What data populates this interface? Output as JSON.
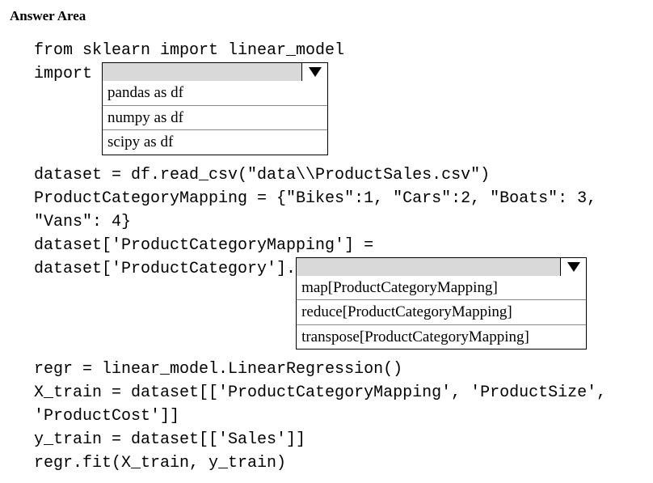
{
  "header": "Answer Area",
  "code": {
    "line1": "from sklearn import linear_model",
    "line2_prefix": "import ",
    "line3": "dataset = df.read_csv(\"data\\\\ProductSales.csv\")",
    "line4": "ProductCategoryMapping = {\"Bikes\":1, \"Cars\":2, \"Boats\": 3,",
    "line5": "\"Vans\": 4}",
    "line6": "dataset['ProductCategoryMapping'] =",
    "line7_prefix": "dataset['ProductCategory'].",
    "line8": "regr = linear_model.LinearRegression()",
    "line9": "X_train = dataset[['ProductCategoryMapping', 'ProductSize',",
    "line10": "'ProductCost']]",
    "line11": "y_train = dataset[['Sales']]",
    "line12": "regr.fit(X_train, y_train)"
  },
  "dropdown1": {
    "selected": "",
    "options": [
      "pandas as df",
      "numpy as df",
      "scipy as df"
    ]
  },
  "dropdown2": {
    "selected": "",
    "options": [
      "map[ProductCategoryMapping]",
      "reduce[ProductCategoryMapping]",
      "transpose[ProductCategoryMapping]"
    ]
  }
}
